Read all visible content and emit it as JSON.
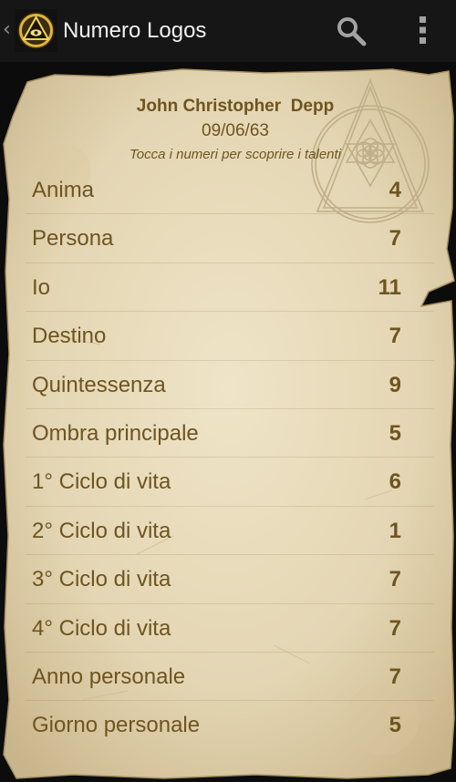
{
  "action_bar": {
    "title": "Numero Logos",
    "up_icon": "chevron-left-icon",
    "app_icon": "eye-of-providence-icon",
    "search_icon": "search-icon",
    "overflow_icon": "overflow-menu-icon"
  },
  "header": {
    "name": "John Christopher  Depp",
    "date": "09/06/63",
    "hint": "Tocca i numeri per scoprire i talenti"
  },
  "rows": [
    {
      "label": "Anima",
      "value": "4"
    },
    {
      "label": "Persona",
      "value": "7"
    },
    {
      "label": "Io",
      "value": "11"
    },
    {
      "label": "Destino",
      "value": "7"
    },
    {
      "label": "Quintessenza",
      "value": "9"
    },
    {
      "label": "Ombra principale",
      "value": "5"
    },
    {
      "label": "1° Ciclo di vita",
      "value": "6"
    },
    {
      "label": "2° Ciclo di vita",
      "value": "1"
    },
    {
      "label": "3° Ciclo di vita",
      "value": "7"
    },
    {
      "label": "4° Ciclo di vita",
      "value": "7"
    },
    {
      "label": "Anno personale",
      "value": "7"
    },
    {
      "label": "Giorno personale",
      "value": "5"
    }
  ],
  "colors": {
    "action_bar": "#161616",
    "background": "#0c0c0c",
    "parchment": "#e6d9ba",
    "text": "#6e5420"
  }
}
